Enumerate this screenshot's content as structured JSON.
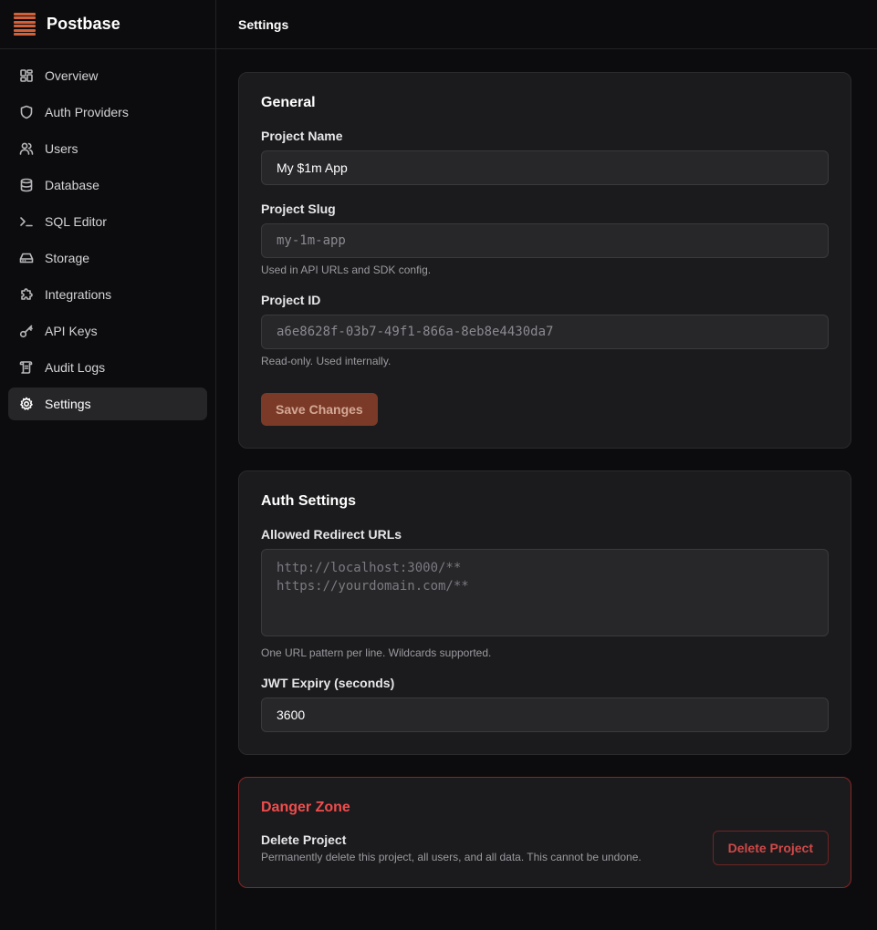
{
  "brand": {
    "name": "Postbase"
  },
  "sidebar": {
    "items": [
      {
        "label": "Overview",
        "icon": "grid-icon"
      },
      {
        "label": "Auth Providers",
        "icon": "shield-icon"
      },
      {
        "label": "Users",
        "icon": "users-icon"
      },
      {
        "label": "Database",
        "icon": "database-icon"
      },
      {
        "label": "SQL Editor",
        "icon": "terminal-icon"
      },
      {
        "label": "Storage",
        "icon": "hard-drive-icon"
      },
      {
        "label": "Integrations",
        "icon": "puzzle-icon"
      },
      {
        "label": "API Keys",
        "icon": "key-icon"
      },
      {
        "label": "Audit Logs",
        "icon": "scroll-icon"
      },
      {
        "label": "Settings",
        "icon": "gear-icon",
        "active": true
      }
    ]
  },
  "header": {
    "title": "Settings"
  },
  "general": {
    "title": "General",
    "project_name": {
      "label": "Project Name",
      "value": "My $1m App"
    },
    "project_slug": {
      "label": "Project Slug",
      "value": "my-1m-app",
      "help": "Used in API URLs and SDK config."
    },
    "project_id": {
      "label": "Project ID",
      "value": "a6e8628f-03b7-49f1-866a-8eb8e4430da7",
      "help": "Read-only. Used internally."
    },
    "save_label": "Save Changes"
  },
  "auth": {
    "title": "Auth Settings",
    "redirect": {
      "label": "Allowed Redirect URLs",
      "placeholder": "http://localhost:3000/**\nhttps://yourdomain.com/**",
      "help": "One URL pattern per line. Wildcards supported."
    },
    "jwt": {
      "label": "JWT Expiry (seconds)",
      "value": "3600"
    }
  },
  "danger": {
    "title": "Danger Zone",
    "delete_label": "Delete Project",
    "delete_desc": "Permanently delete this project, all users, and all data. This cannot be undone.",
    "delete_button": "Delete Project"
  },
  "colors": {
    "accent": "#d2603a",
    "danger": "#f04d4d"
  }
}
